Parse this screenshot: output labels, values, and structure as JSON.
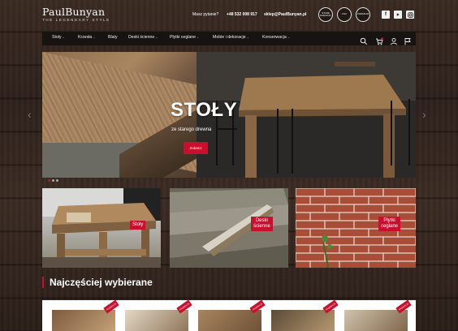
{
  "brand": {
    "logo_text": "PaulBunyan",
    "tagline": "THE LEGENDARY STYLE"
  },
  "contact": {
    "question": "Masz pytanie?",
    "phone": "+48 532 008 917",
    "email": "sklep@PaulBunyan.pl"
  },
  "badges": [
    "STARE DREWNO",
    "CNC",
    "PREMIUM"
  ],
  "social": [
    "facebook-icon",
    "youtube-icon",
    "instagram-icon"
  ],
  "nav": {
    "items": [
      {
        "label": "Stoły",
        "chevron": "⌄"
      },
      {
        "label": "Krzesła",
        "chevron": "⌄"
      },
      {
        "label": "Blaty",
        "chevron": ""
      },
      {
        "label": "Deski ścienne",
        "chevron": "⌄"
      },
      {
        "label": "Płytki ceglane",
        "chevron": "⌄"
      },
      {
        "label": "Meble i dekoracje",
        "chevron": "⌄"
      },
      {
        "label": "Konserwacja",
        "chevron": "⌄"
      }
    ],
    "icons": [
      "search-icon",
      "cart-icon",
      "user-icon",
      "flag-icon"
    ],
    "cart_count": "0"
  },
  "hero": {
    "title": "STOŁY",
    "subtitle": "ze starego drewna",
    "button": "Zobacz",
    "slide_dots": 3,
    "active_dot": 0
  },
  "tiles": [
    {
      "label": "Stoły"
    },
    {
      "label": "Deski\nścienne"
    },
    {
      "label": "Płytki\nceglane"
    }
  ],
  "section": {
    "title": "Najczęściej wybierane"
  },
  "products": {
    "ribbon": "PROMOCJA"
  },
  "colors": {
    "accent": "#c8102e",
    "nav_bg": "#171311"
  }
}
